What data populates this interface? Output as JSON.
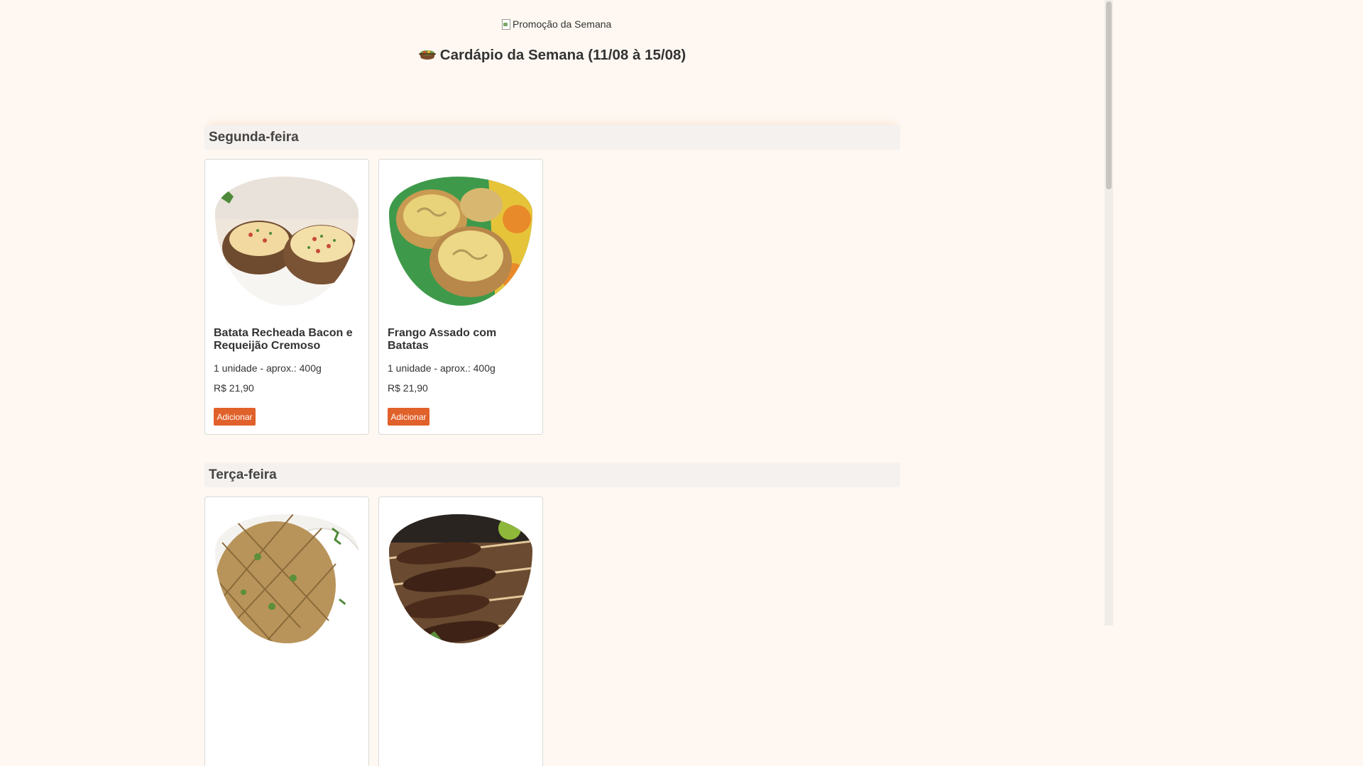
{
  "header": {
    "promo_image_alt": "Promoção da Semana",
    "menu_title": "Cardápio da Semana (11/08 à 15/08)",
    "title_icon": "pot-of-food-icon"
  },
  "days": [
    {
      "name": "Segunda-feira",
      "items": [
        {
          "name": "Batata Recheada Bacon e Requeijão Cremoso",
          "portion": "1 unidade - aprox.: 400g",
          "price": "R$ 21,90",
          "button": "Adicionar"
        },
        {
          "name": "Frango Assado com Batatas",
          "portion": "1 unidade - aprox.: 400g",
          "price": "R$ 21,90",
          "button": "Adicionar"
        }
      ]
    },
    {
      "name": "Terça-feira",
      "items": [
        {
          "photo": "kibe-assado"
        },
        {
          "photo": "kafta-espetos"
        }
      ]
    }
  ],
  "colors": {
    "background": "#fff8f2",
    "button": "#e0612a",
    "day_header": "#f5f1ee"
  }
}
